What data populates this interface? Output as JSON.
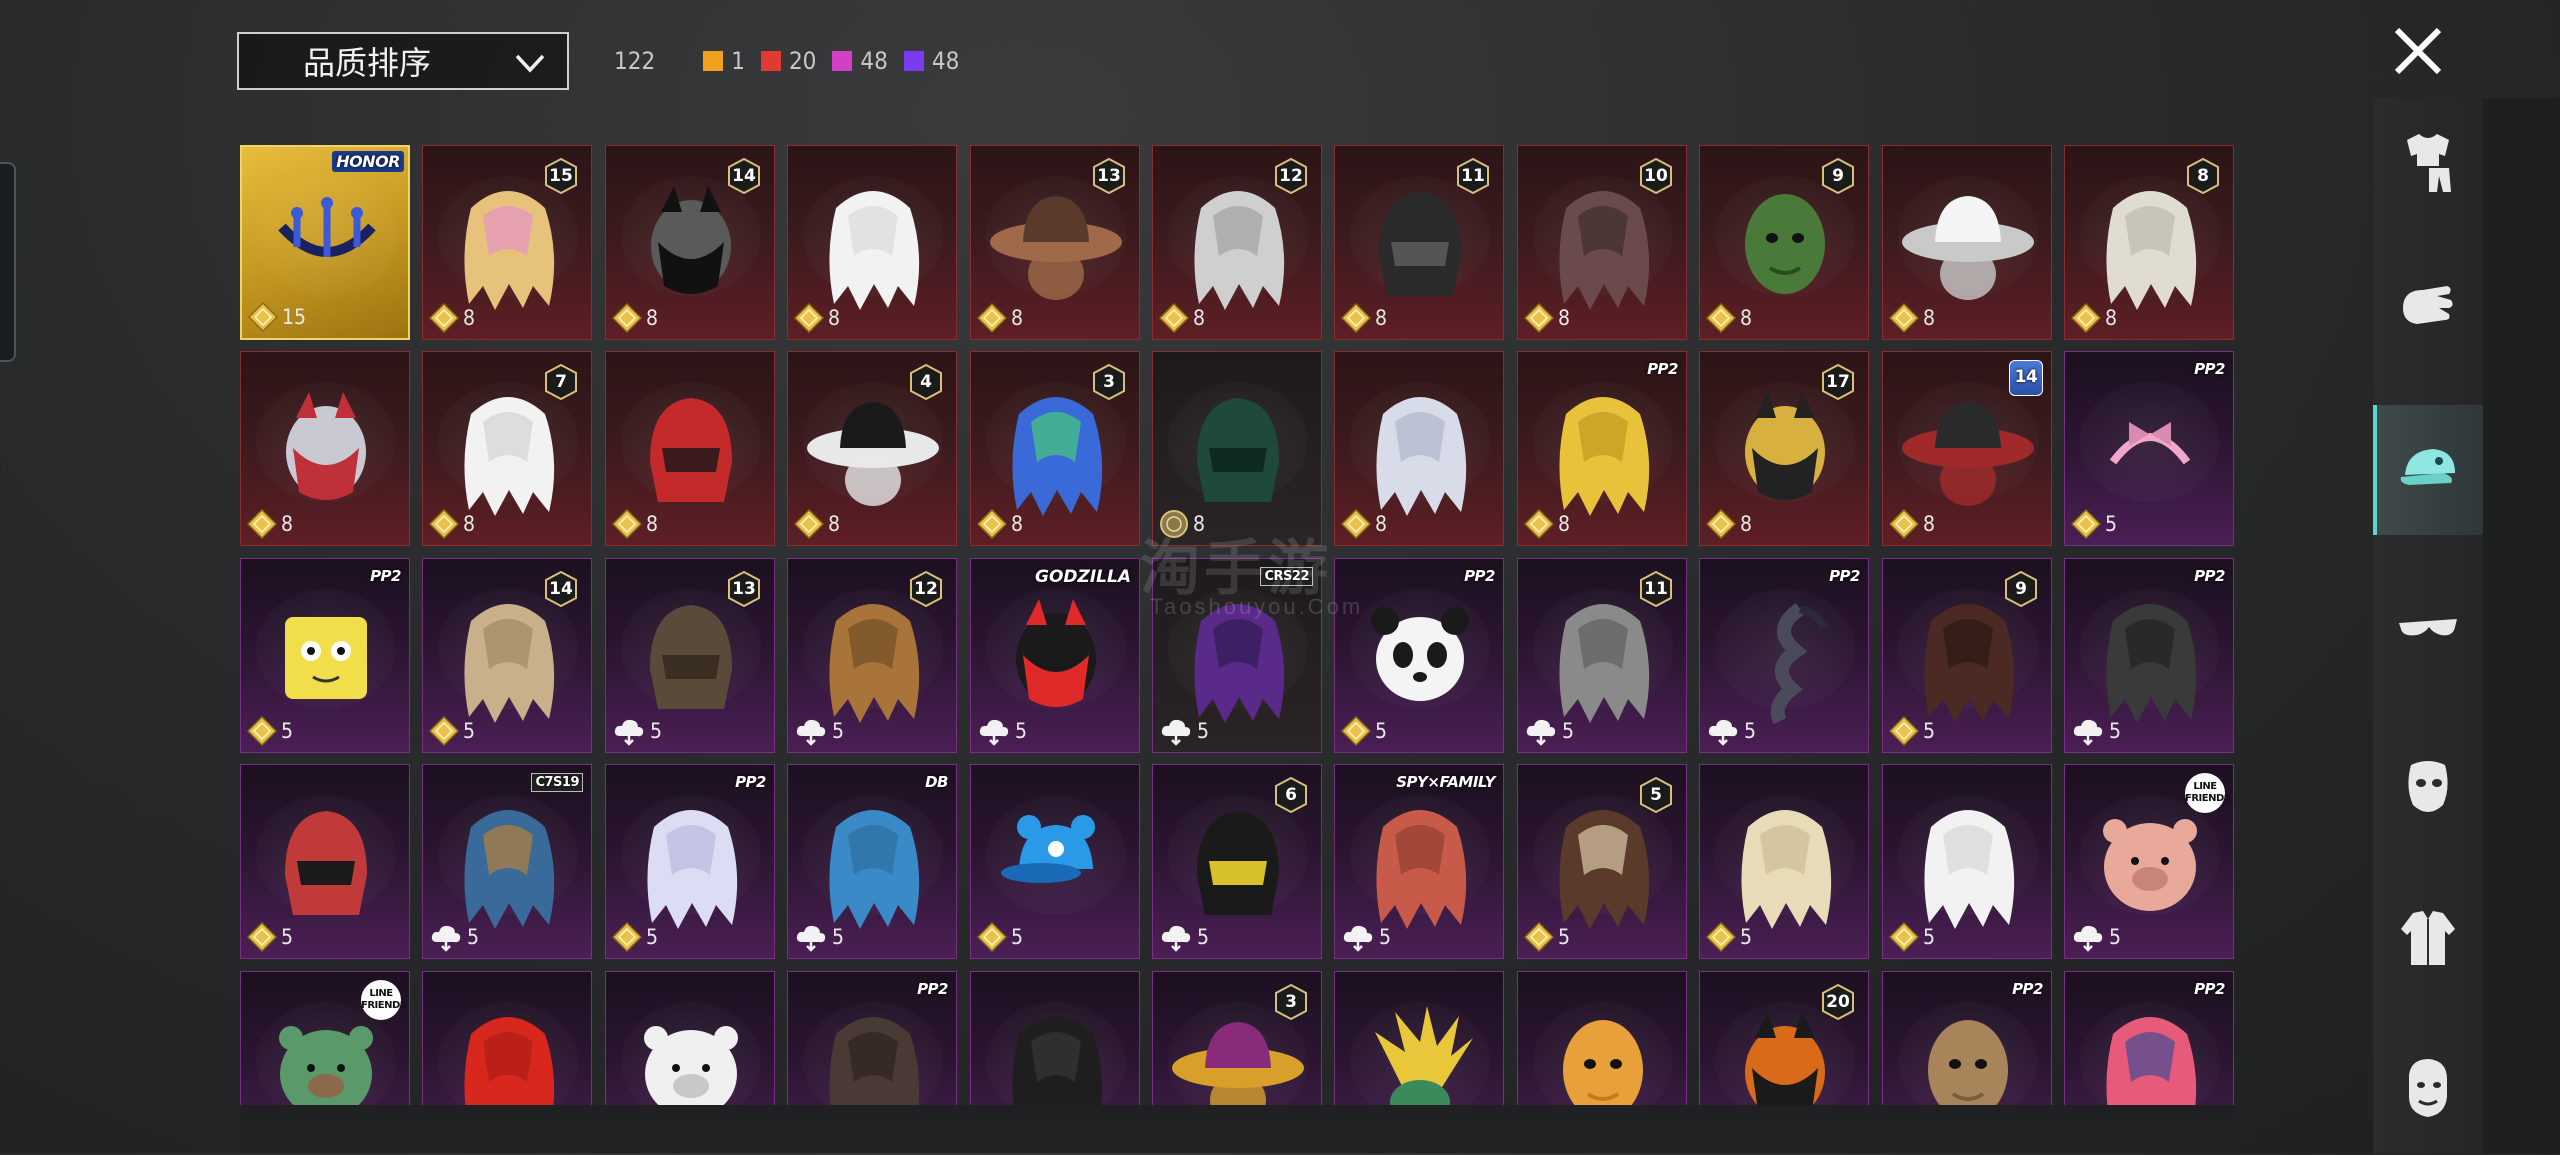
{
  "header": {
    "sort_label": "品质排序",
    "total_count": "122",
    "rarity_counts": [
      {
        "color": "#f0a21e",
        "value": "1"
      },
      {
        "color": "#e03a32",
        "value": "20"
      },
      {
        "color": "#d43fc7",
        "value": "48"
      },
      {
        "color": "#7a3cf0",
        "value": "48"
      }
    ]
  },
  "watermark": {
    "main": "淘手游",
    "sub": "Taoshouyou.Com"
  },
  "categories": [
    {
      "icon": "outfit-icon",
      "selected": false
    },
    {
      "icon": "hand-icon",
      "selected": false
    },
    {
      "icon": "hat-icon",
      "selected": true
    },
    {
      "icon": "glasses-icon",
      "selected": false
    },
    {
      "icon": "mask-icon",
      "selected": false
    },
    {
      "icon": "jacket-icon",
      "selected": false
    },
    {
      "icon": "face-icon",
      "selected": false
    }
  ],
  "items": [
    {
      "rarity": "gold",
      "price": "15",
      "currency": "diamond",
      "badge": "HONOR",
      "badge_type": "hk",
      "art": "chandelier",
      "c1": "#1a2060",
      "c2": "#3a5ad8"
    },
    {
      "rarity": "red",
      "price": "8",
      "currency": "diamond",
      "badge": "15",
      "badge_type": "level",
      "art": "hair",
      "c1": "#e7c27a",
      "c2": "#e58bd0"
    },
    {
      "rarity": "red",
      "price": "8",
      "currency": "diamond",
      "badge": "14",
      "badge_type": "level",
      "art": "mask",
      "c1": "#5a5a5a",
      "c2": "#111111"
    },
    {
      "rarity": "red",
      "price": "8",
      "currency": "diamond",
      "badge": "",
      "badge_type": "",
      "art": "hair",
      "c1": "#f2f2f2",
      "c2": "#d7d7d7"
    },
    {
      "rarity": "red",
      "price": "8",
      "currency": "diamond",
      "badge": "13",
      "badge_type": "level",
      "art": "hat",
      "c1": "#5a3a2a",
      "c2": "#a06a4a"
    },
    {
      "rarity": "red",
      "price": "8",
      "currency": "diamond",
      "badge": "12",
      "badge_type": "level",
      "art": "hair",
      "c1": "#cfcfcf",
      "c2": "#9a9a9a"
    },
    {
      "rarity": "red",
      "price": "8",
      "currency": "diamond",
      "badge": "11",
      "badge_type": "level",
      "art": "helmet",
      "c1": "#2a2a2a",
      "c2": "#555555"
    },
    {
      "rarity": "red",
      "price": "8",
      "currency": "diamond",
      "badge": "10",
      "badge_type": "level",
      "art": "hair",
      "c1": "#6a4a4a",
      "c2": "#3a2a2a"
    },
    {
      "rarity": "red",
      "price": "8",
      "currency": "diamond",
      "badge": "9",
      "badge_type": "level",
      "art": "head",
      "c1": "#4a7a3a",
      "c2": "#2a4a22"
    },
    {
      "rarity": "red",
      "price": "8",
      "currency": "diamond",
      "badge": "",
      "badge_type": "",
      "art": "hat",
      "c1": "#f4f4f4",
      "c2": "#c9c9c9"
    },
    {
      "rarity": "red",
      "price": "8",
      "currency": "diamond",
      "badge": "8",
      "badge_type": "level",
      "art": "hair",
      "c1": "#e0dcd0",
      "c2": "#b8b4a8"
    },
    {
      "rarity": "red",
      "price": "8",
      "currency": "diamond",
      "badge": "",
      "badge_type": "",
      "art": "mask",
      "c1": "#c9c9d4",
      "c2": "#c0303a"
    },
    {
      "rarity": "red",
      "price": "8",
      "currency": "diamond",
      "badge": "7",
      "badge_type": "level",
      "art": "hair",
      "c1": "#f2f2f2",
      "c2": "#cfcfcf"
    },
    {
      "rarity": "red",
      "price": "8",
      "currency": "diamond",
      "badge": "",
      "badge_type": "",
      "art": "helmet",
      "c1": "#c42a2a",
      "c2": "#3a1a1a"
    },
    {
      "rarity": "red",
      "price": "8",
      "currency": "diamond",
      "badge": "4",
      "badge_type": "level",
      "art": "hat",
      "c1": "#1a1a1a",
      "c2": "#e8e8e8"
    },
    {
      "rarity": "red",
      "price": "8",
      "currency": "diamond",
      "badge": "3",
      "badge_type": "level",
      "art": "hair",
      "c1": "#3a6ad8",
      "c2": "#4ad86a"
    },
    {
      "rarity": "red",
      "price": "8",
      "currency": "coin",
      "badge": "",
      "badge_type": "",
      "art": "helmet",
      "c1": "#1f4a3a",
      "c2": "#0e2a22",
      "dark": true
    },
    {
      "rarity": "red",
      "price": "8",
      "currency": "diamond",
      "badge": "",
      "badge_type": "",
      "art": "hair",
      "c1": "#d8dce8",
      "c2": "#aab0c4"
    },
    {
      "rarity": "red",
      "price": "8",
      "currency": "diamond",
      "badge": "PP2",
      "badge_type": "brand",
      "art": "hair",
      "c1": "#e8c23a",
      "c2": "#b8921a"
    },
    {
      "rarity": "red",
      "price": "8",
      "currency": "diamond",
      "badge": "17",
      "badge_type": "level",
      "art": "mask",
      "c1": "#d8b040",
      "c2": "#222222"
    },
    {
      "rarity": "red",
      "price": "8",
      "currency": "diamond",
      "badge": "14",
      "badge_type": "blue",
      "art": "hat",
      "c1": "#2a2a2a",
      "c2": "#a02a2a"
    },
    {
      "rarity": "purple",
      "price": "5",
      "currency": "diamond",
      "badge": "PP2",
      "badge_type": "brand",
      "art": "headband",
      "c1": "#f0a8c8",
      "c2": "#d88ab0"
    },
    {
      "rarity": "purple",
      "price": "5",
      "currency": "diamond",
      "badge": "PP2",
      "badge_type": "brand",
      "art": "box",
      "c1": "#f2de4a",
      "c2": "#c8b030"
    },
    {
      "rarity": "purple",
      "price": "5",
      "currency": "diamond",
      "badge": "14",
      "badge_type": "level",
      "art": "hair",
      "c1": "#c8b08a",
      "c2": "#9a845e"
    },
    {
      "rarity": "purple",
      "price": "5",
      "currency": "cloud",
      "badge": "13",
      "badge_type": "level",
      "art": "helmet",
      "c1": "#5a4a3a",
      "c2": "#3a2e22"
    },
    {
      "rarity": "purple",
      "price": "5",
      "currency": "cloud",
      "badge": "12",
      "badge_type": "level",
      "art": "hair",
      "c1": "#a8743a",
      "c2": "#6a4a22"
    },
    {
      "rarity": "purple",
      "price": "5",
      "currency": "cloud",
      "badge": "GODZILLA",
      "badge_type": "gz",
      "art": "mask",
      "c1": "#1a1a1a",
      "c2": "#e02a2a"
    },
    {
      "rarity": "purple",
      "price": "5",
      "currency": "cloud",
      "badge": "CRS22",
      "badge_type": "box",
      "art": "hair",
      "c1": "#5a2a8a",
      "c2": "#2a1a4a",
      "dark": true
    },
    {
      "rarity": "purple",
      "price": "5",
      "currency": "diamond",
      "badge": "PP2",
      "badge_type": "brand",
      "art": "panda",
      "c1": "#f4f4f4",
      "c2": "#1a1a1a"
    },
    {
      "rarity": "purple",
      "price": "5",
      "currency": "cloud",
      "badge": "11",
      "badge_type": "level",
      "art": "hair",
      "c1": "#8a8a8a",
      "c2": "#5a5a5a"
    },
    {
      "rarity": "purple",
      "price": "5",
      "currency": "cloud",
      "badge": "PP2",
      "badge_type": "brand",
      "art": "braid",
      "c1": "#4a4a5a",
      "c2": "#2a2a3a"
    },
    {
      "rarity": "purple",
      "price": "5",
      "currency": "diamond",
      "badge": "9",
      "badge_type": "level",
      "art": "hair",
      "c1": "#4a2a22",
      "c2": "#2a1812"
    },
    {
      "rarity": "purple",
      "price": "5",
      "currency": "cloud",
      "badge": "PP2",
      "badge_type": "brand",
      "art": "hair",
      "c1": "#3a3a3a",
      "c2": "#1e1e1e"
    },
    {
      "rarity": "purple",
      "price": "5",
      "currency": "diamond",
      "badge": "",
      "badge_type": "",
      "art": "helmet",
      "c1": "#c03a3a",
      "c2": "#1a1a1a"
    },
    {
      "rarity": "purple",
      "price": "5",
      "currency": "cloud",
      "badge": "C7S19",
      "badge_type": "box",
      "art": "hair",
      "c1": "#3a6a9a",
      "c2": "#c8842a"
    },
    {
      "rarity": "purple",
      "price": "5",
      "currency": "diamond",
      "badge": "PP2",
      "badge_type": "brand",
      "art": "hair",
      "c1": "#dcdcf4",
      "c2": "#b4b4d8"
    },
    {
      "rarity": "purple",
      "price": "5",
      "currency": "cloud",
      "badge": "DB",
      "badge_type": "brand",
      "art": "hair",
      "c1": "#3a8ac8",
      "c2": "#2a6a9a"
    },
    {
      "rarity": "purple",
      "price": "5",
      "currency": "diamond",
      "badge": "",
      "badge_type": "",
      "art": "cap",
      "c1": "#2a9ae8",
      "c2": "#1a6ab8"
    },
    {
      "rarity": "purple",
      "price": "5",
      "currency": "cloud",
      "badge": "6",
      "badge_type": "level",
      "art": "helmet",
      "c1": "#1a1a1a",
      "c2": "#d8c02a"
    },
    {
      "rarity": "purple",
      "price": "5",
      "currency": "cloud",
      "badge": "SPY×FAMILY",
      "badge_type": "brand",
      "art": "hair",
      "c1": "#c85a4a",
      "c2": "#8a3a2e"
    },
    {
      "rarity": "purple",
      "price": "5",
      "currency": "diamond",
      "badge": "5",
      "badge_type": "level",
      "art": "hair",
      "c1": "#5a3a2a",
      "c2": "#f0e0c0"
    },
    {
      "rarity": "purple",
      "price": "5",
      "currency": "diamond",
      "badge": "",
      "badge_type": "",
      "art": "hair",
      "c1": "#e8dcb8",
      "c2": "#c8b88e"
    },
    {
      "rarity": "purple",
      "price": "5",
      "currency": "diamond",
      "badge": "",
      "badge_type": "",
      "art": "hair",
      "c1": "#f2f2f2",
      "c2": "#d2d2d2"
    },
    {
      "rarity": "purple",
      "price": "5",
      "currency": "cloud",
      "badge": "LINE FRIENDS",
      "badge_type": "circ",
      "art": "bear",
      "c1": "#e8a89a",
      "c2": "#c8847a"
    },
    {
      "rarity": "purple",
      "price": "",
      "currency": "",
      "badge": "LINE FRIENDS",
      "badge_type": "circ",
      "art": "bear",
      "c1": "#5a9a6a",
      "c2": "#8a6a4a"
    },
    {
      "rarity": "purple",
      "price": "",
      "currency": "",
      "badge": "",
      "badge_type": "",
      "art": "hair",
      "c1": "#d8281e",
      "c2": "#a81a14"
    },
    {
      "rarity": "purple",
      "price": "",
      "currency": "",
      "badge": "",
      "badge_type": "",
      "art": "bear",
      "c1": "#f0f0f0",
      "c2": "#c8c8c8"
    },
    {
      "rarity": "purple",
      "price": "",
      "currency": "",
      "badge": "PP2",
      "badge_type": "brand",
      "art": "hair",
      "c1": "#4a3a36",
      "c2": "#2a201e"
    },
    {
      "rarity": "purple",
      "price": "",
      "currency": "",
      "badge": "",
      "badge_type": "",
      "art": "hair",
      "c1": "#1e1e1e",
      "c2": "#3a3a3a"
    },
    {
      "rarity": "purple",
      "price": "",
      "currency": "",
      "badge": "3",
      "badge_type": "level",
      "art": "hat",
      "c1": "#8a2a7a",
      "c2": "#d8a02a"
    },
    {
      "rarity": "purple",
      "price": "",
      "currency": "",
      "badge": "",
      "badge_type": "",
      "art": "feathers",
      "c1": "#e8c83a",
      "c2": "#3a8a5a"
    },
    {
      "rarity": "purple",
      "price": "",
      "currency": "",
      "badge": "",
      "badge_type": "",
      "art": "head",
      "c1": "#e8a03a",
      "c2": "#c87a1a"
    },
    {
      "rarity": "purple",
      "price": "",
      "currency": "",
      "badge": "20",
      "badge_type": "level",
      "art": "mask",
      "c1": "#d86a1a",
      "c2": "#1a1a1a"
    },
    {
      "rarity": "purple",
      "price": "",
      "currency": "",
      "badge": "PP2",
      "badge_type": "brand",
      "art": "head",
      "c1": "#a8845a",
      "c2": "#7a5e3a"
    },
    {
      "rarity": "purple",
      "price": "",
      "currency": "",
      "badge": "PP2",
      "badge_type": "brand",
      "art": "hair",
      "c1": "#e85a7a",
      "c2": "#2a4a9a"
    }
  ]
}
